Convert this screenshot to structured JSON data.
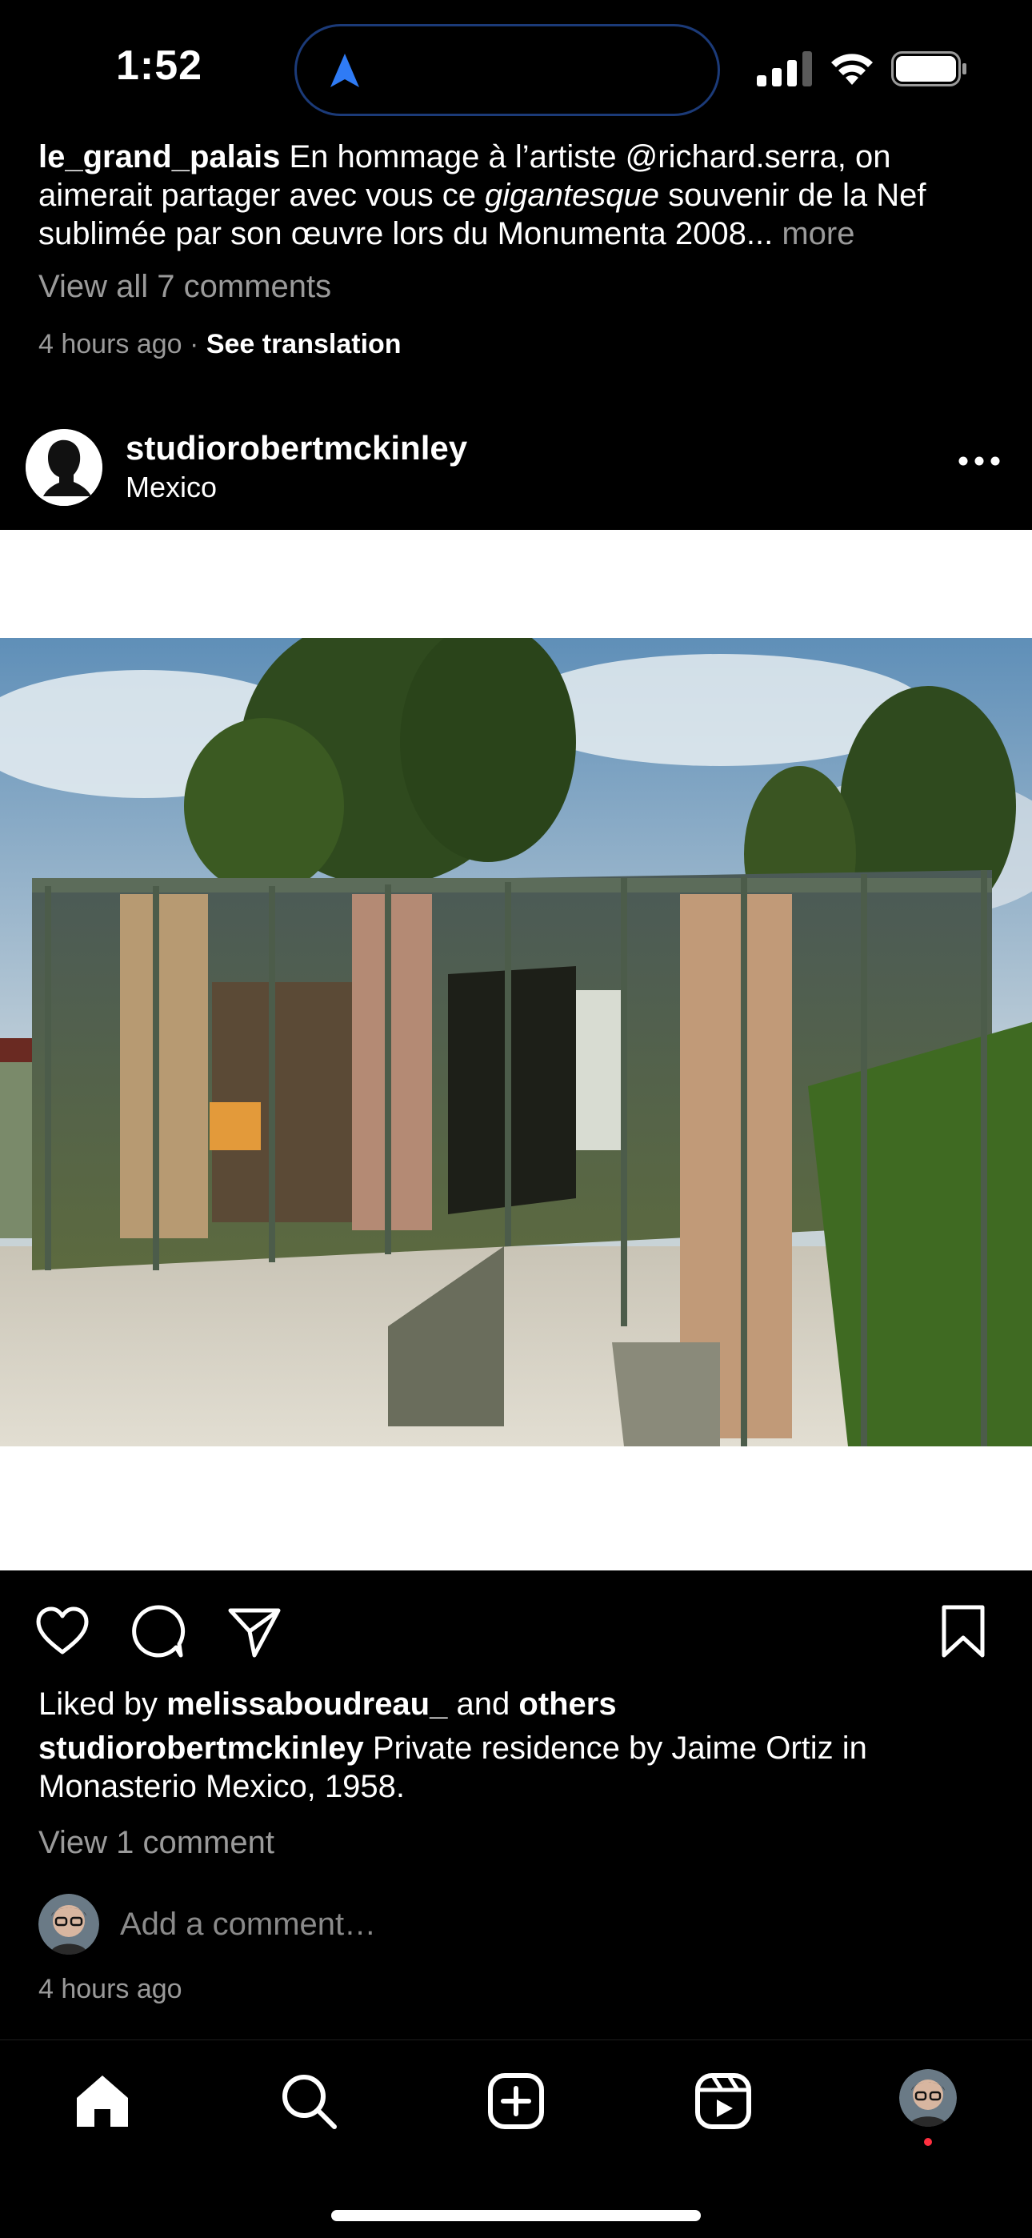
{
  "status_bar": {
    "time": "1:52",
    "icons": [
      "navigation-arrow-icon",
      "signal-icon",
      "wifi-icon",
      "battery-icon"
    ]
  },
  "previous_post": {
    "username": "le_grand_palais",
    "caption_part1": " En hommage à l’artiste @richard.serra, on aimerait partager avec vous ce ",
    "caption_italic": "gigantesque",
    "caption_part2": " souvenir de la Nef sublimée par son œuvre lors du Monumenta 2008...",
    "more_label": " more",
    "view_comments": "View all 7 comments",
    "time_ago": "4 hours ago",
    "separator": " · ",
    "see_translation": "See translation"
  },
  "post": {
    "username": "studiorobertmckinley",
    "location": "Mexico",
    "liked_by_prefix": "Liked by ",
    "liked_by_user": "melissaboudreau_",
    "liked_by_and": " and ",
    "liked_by_others": "others",
    "caption_user": "studiorobertmckinley",
    "caption_text": " Private residence by Jaime Ortiz in Monasterio Mexico, 1958.",
    "view_comment": "View 1 comment",
    "add_comment_placeholder": "Add a comment…",
    "time_ago": "4 hours ago"
  },
  "actions": {
    "icons": [
      "heart-icon",
      "comment-icon",
      "share-icon",
      "bookmark-icon"
    ]
  },
  "tab_bar": {
    "items": [
      "home-icon",
      "search-icon",
      "create-icon",
      "reels-icon",
      "profile-avatar"
    ]
  },
  "colors": {
    "background": "#000000",
    "muted_text": "#9a9a9a",
    "notification": "#ff3040",
    "island_border": "#1b3a78",
    "nav_arrow": "#2f7bf5"
  }
}
